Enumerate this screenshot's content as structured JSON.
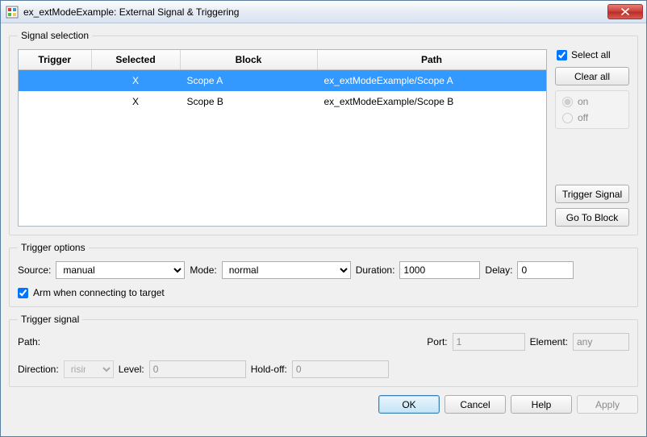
{
  "title": "ex_extModeExample: External Signal & Triggering",
  "sections": {
    "signal_selection": "Signal selection",
    "trigger_options": "Trigger options",
    "trigger_signal": "Trigger signal"
  },
  "table": {
    "headers": {
      "trigger": "Trigger",
      "selected": "Selected",
      "block": "Block",
      "path": "Path"
    },
    "rows": [
      {
        "trigger": "",
        "selected": "X",
        "block": "Scope A",
        "path": "ex_extModeExample/Scope A",
        "is_selected": true
      },
      {
        "trigger": "",
        "selected": "X",
        "block": "Scope B",
        "path": "ex_extModeExample/Scope B",
        "is_selected": false
      }
    ]
  },
  "side": {
    "select_all_label": "Select all",
    "select_all_checked": true,
    "clear_all": "Clear all",
    "on": "on",
    "off": "off",
    "trigger_signal": "Trigger Signal",
    "go_to_block": "Go To Block"
  },
  "trigger_options": {
    "source_label": "Source:",
    "source_value": "manual",
    "mode_label": "Mode:",
    "mode_value": "normal",
    "duration_label": "Duration:",
    "duration_value": "1000",
    "delay_label": "Delay:",
    "delay_value": "0",
    "arm_label": "Arm when connecting to target",
    "arm_checked": true
  },
  "trigger_signal": {
    "path_label": "Path:",
    "path_value": "",
    "port_label": "Port:",
    "port_value": "1",
    "element_label": "Element:",
    "element_value": "any",
    "direction_label": "Direction:",
    "direction_value": "rising",
    "level_label": "Level:",
    "level_value": "0",
    "holdoff_label": "Hold-off:",
    "holdoff_value": "0"
  },
  "buttons": {
    "ok": "OK",
    "cancel": "Cancel",
    "help": "Help",
    "apply": "Apply"
  }
}
